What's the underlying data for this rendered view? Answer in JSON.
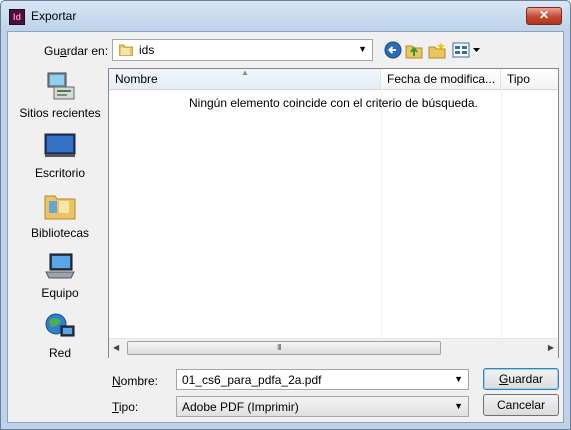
{
  "window": {
    "title": "Exportar",
    "app_icon": "Id",
    "close_glyph": "✕"
  },
  "toolbar": {
    "look_in_label_pre": "Gu",
    "look_in_label_accel": "a",
    "look_in_label_post": "rdar en:",
    "current_folder": "ids",
    "icons": [
      "back-icon",
      "up-folder-icon",
      "new-folder-icon",
      "view-menu-icon"
    ]
  },
  "places": [
    {
      "label": "Sitios recientes",
      "icon": "recent-places-icon"
    },
    {
      "label": "Escritorio",
      "icon": "desktop-icon"
    },
    {
      "label": "Bibliotecas",
      "icon": "libraries-icon"
    },
    {
      "label": "Equipo",
      "icon": "computer-icon"
    },
    {
      "label": "Red",
      "icon": "network-icon"
    }
  ],
  "filelist": {
    "columns": [
      "Nombre",
      "Fecha de modifica...",
      "Tipo"
    ],
    "empty_message": "Ningún elemento coincide con el criterio de búsqueda.",
    "scroll_grip": "III"
  },
  "form": {
    "filename_label_accel": "N",
    "filename_label_rest": "ombre:",
    "filename_value": "01_cs6_para_pdfa_2a.pdf",
    "type_label_accel": "T",
    "type_label_rest": "ipo:",
    "type_value": "Adobe PDF (Imprimir)"
  },
  "buttons": {
    "save_accel": "G",
    "save_rest": "uardar",
    "cancel": "Cancelar"
  },
  "colors": {
    "accent": "#3c7fb1",
    "titlebar": "#bcd3ea",
    "close": "#c7462e"
  }
}
